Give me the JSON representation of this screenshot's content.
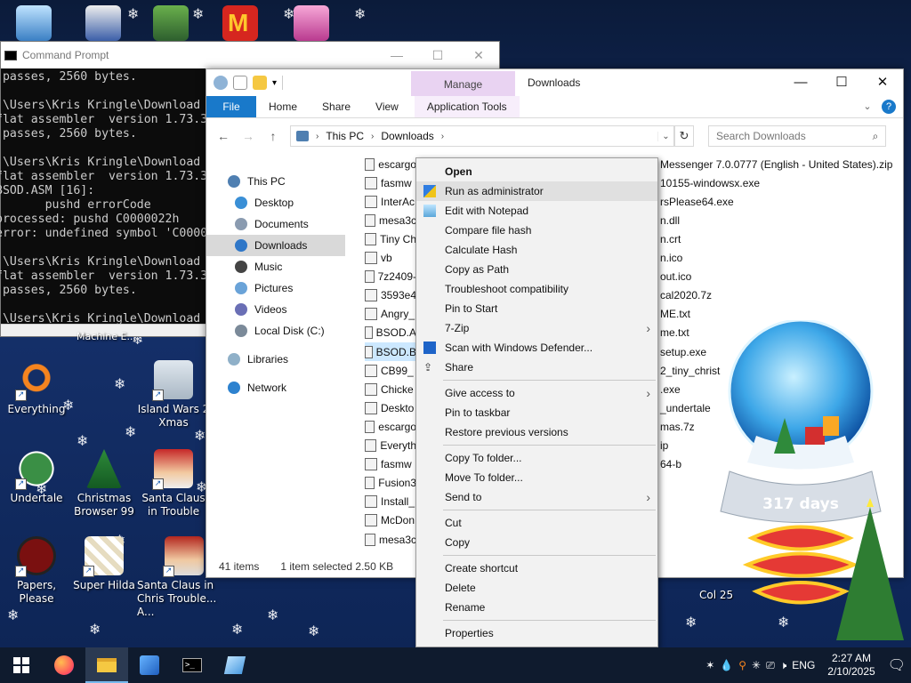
{
  "desktop": {
    "icons": [
      {
        "label": "Everything"
      },
      {
        "label": "Island Wars 2 Xmas"
      },
      {
        "label": "Undertale"
      },
      {
        "label": "Christmas Browser 99"
      },
      {
        "label": "Santa Claus in Trouble"
      },
      {
        "label": "Papers, Please"
      },
      {
        "label": "Super Hilda"
      },
      {
        "label": "Santa Claus in Chris Trouble... A..."
      }
    ],
    "partial_label": "Machine E..."
  },
  "cmd": {
    "title": "Command Prompt",
    "lines": " passes, 2560 bytes.\n\n:\\Users\\Kris Kringle\\Download\nflat assembler  version 1.73.3\n passes, 2560 bytes.\n\n:\\Users\\Kris Kringle\\Download\nflat assembler  version 1.73.3\nBSOD.ASM [16]:\n       pushd errorCode\nprocessed: pushd C0000022h\nerror: undefined symbol 'C0000\n\n:\\Users\\Kris Kringle\\Download\nflat assembler  version 1.73.3\n passes, 2560 bytes.\n\n:\\Users\\Kris Kringle\\Download"
  },
  "explorer": {
    "window_title": "Downloads",
    "manage_tab": "Manage",
    "tabs": {
      "file": "File",
      "home": "Home",
      "share": "Share",
      "view": "View",
      "app_tools": "Application Tools"
    },
    "address": {
      "part1": "This PC",
      "part2": "Downloads"
    },
    "search_placeholder": "Search Downloads",
    "nav": [
      {
        "label": "This PC",
        "color": "#4f7fb1"
      },
      {
        "label": "Desktop",
        "color": "#3a8fd6"
      },
      {
        "label": "Documents",
        "color": "#8a9bb0"
      },
      {
        "label": "Downloads",
        "color": "#2f77c8"
      },
      {
        "label": "Music",
        "color": "#444444"
      },
      {
        "label": "Pictures",
        "color": "#6aa3d8"
      },
      {
        "label": "Videos",
        "color": "#6a6fb5"
      },
      {
        "label": "Local Disk (C:)",
        "color": "#7b8a99"
      },
      {
        "label": "Libraries",
        "color": "#8fb0c8"
      },
      {
        "label": "Network",
        "color": "#2d82cf"
      }
    ],
    "files_left": [
      "escargo",
      "fasmw",
      "InterAc",
      "mesa3c",
      "Tiny Ch",
      "vb",
      "7z2409-",
      "3593e4",
      "Angry_",
      "BSOD.A",
      "BSOD.B",
      "CB99_",
      "Chicke",
      "Deskto",
      "escargo",
      "Everyth",
      "fasmw",
      "Fusion3",
      "Install_",
      "McDon",
      "mesa3c"
    ],
    "files_right": [
      "Messenger 7.0.0777 (English - United States).zip",
      "10155-windowsx.exe",
      "rsPlease64.exe",
      "n.dll",
      "n.crt",
      "n.ico",
      "out.ico",
      "cal2020.7z",
      " ME.txt",
      "me.txt",
      "setup.exe",
      "2_tiny_christ",
      ".exe",
      "_undertale",
      "mas.7z",
      "ip",
      "64-b"
    ],
    "status": {
      "items": "41 items",
      "selected": "1 item selected  2.50 KB"
    },
    "col_hint": "Col 25"
  },
  "context_menu": {
    "items": [
      {
        "label": "Open",
        "bold": true
      },
      {
        "label": "Run as administrator",
        "icon": "shield-icon"
      },
      {
        "label": "Edit with Notepad",
        "icon": "notepad-icon"
      },
      {
        "label": "Compare file hash"
      },
      {
        "label": "Calculate Hash"
      },
      {
        "label": "Copy as Path"
      },
      {
        "label": "Troubleshoot compatibility"
      },
      {
        "label": "Pin to Start"
      },
      {
        "label": "7-Zip",
        "submenu": true
      },
      {
        "label": "Scan with Windows Defender...",
        "icon": "defender-icon"
      },
      {
        "label": "Share",
        "icon": "share-icon"
      },
      {
        "sep": true
      },
      {
        "label": "Give access to",
        "submenu": true
      },
      {
        "label": "Pin to taskbar"
      },
      {
        "label": "Restore previous versions"
      },
      {
        "sep": true
      },
      {
        "label": "Copy To folder..."
      },
      {
        "label": "Move To folder..."
      },
      {
        "label": "Send to",
        "submenu": true
      },
      {
        "sep": true
      },
      {
        "label": "Cut"
      },
      {
        "label": "Copy"
      },
      {
        "sep": true
      },
      {
        "label": "Create shortcut"
      },
      {
        "label": "Delete"
      },
      {
        "label": "Rename"
      },
      {
        "sep": true
      },
      {
        "label": "Properties"
      }
    ]
  },
  "globe": {
    "days": "317 days"
  },
  "taskbar": {
    "lang": "ENG",
    "time": "2:27 AM",
    "date": "2/10/2025"
  },
  "colors": {
    "accent": "#1979ca",
    "manage": "#e9d3f2",
    "selection": "#cce8ff"
  }
}
